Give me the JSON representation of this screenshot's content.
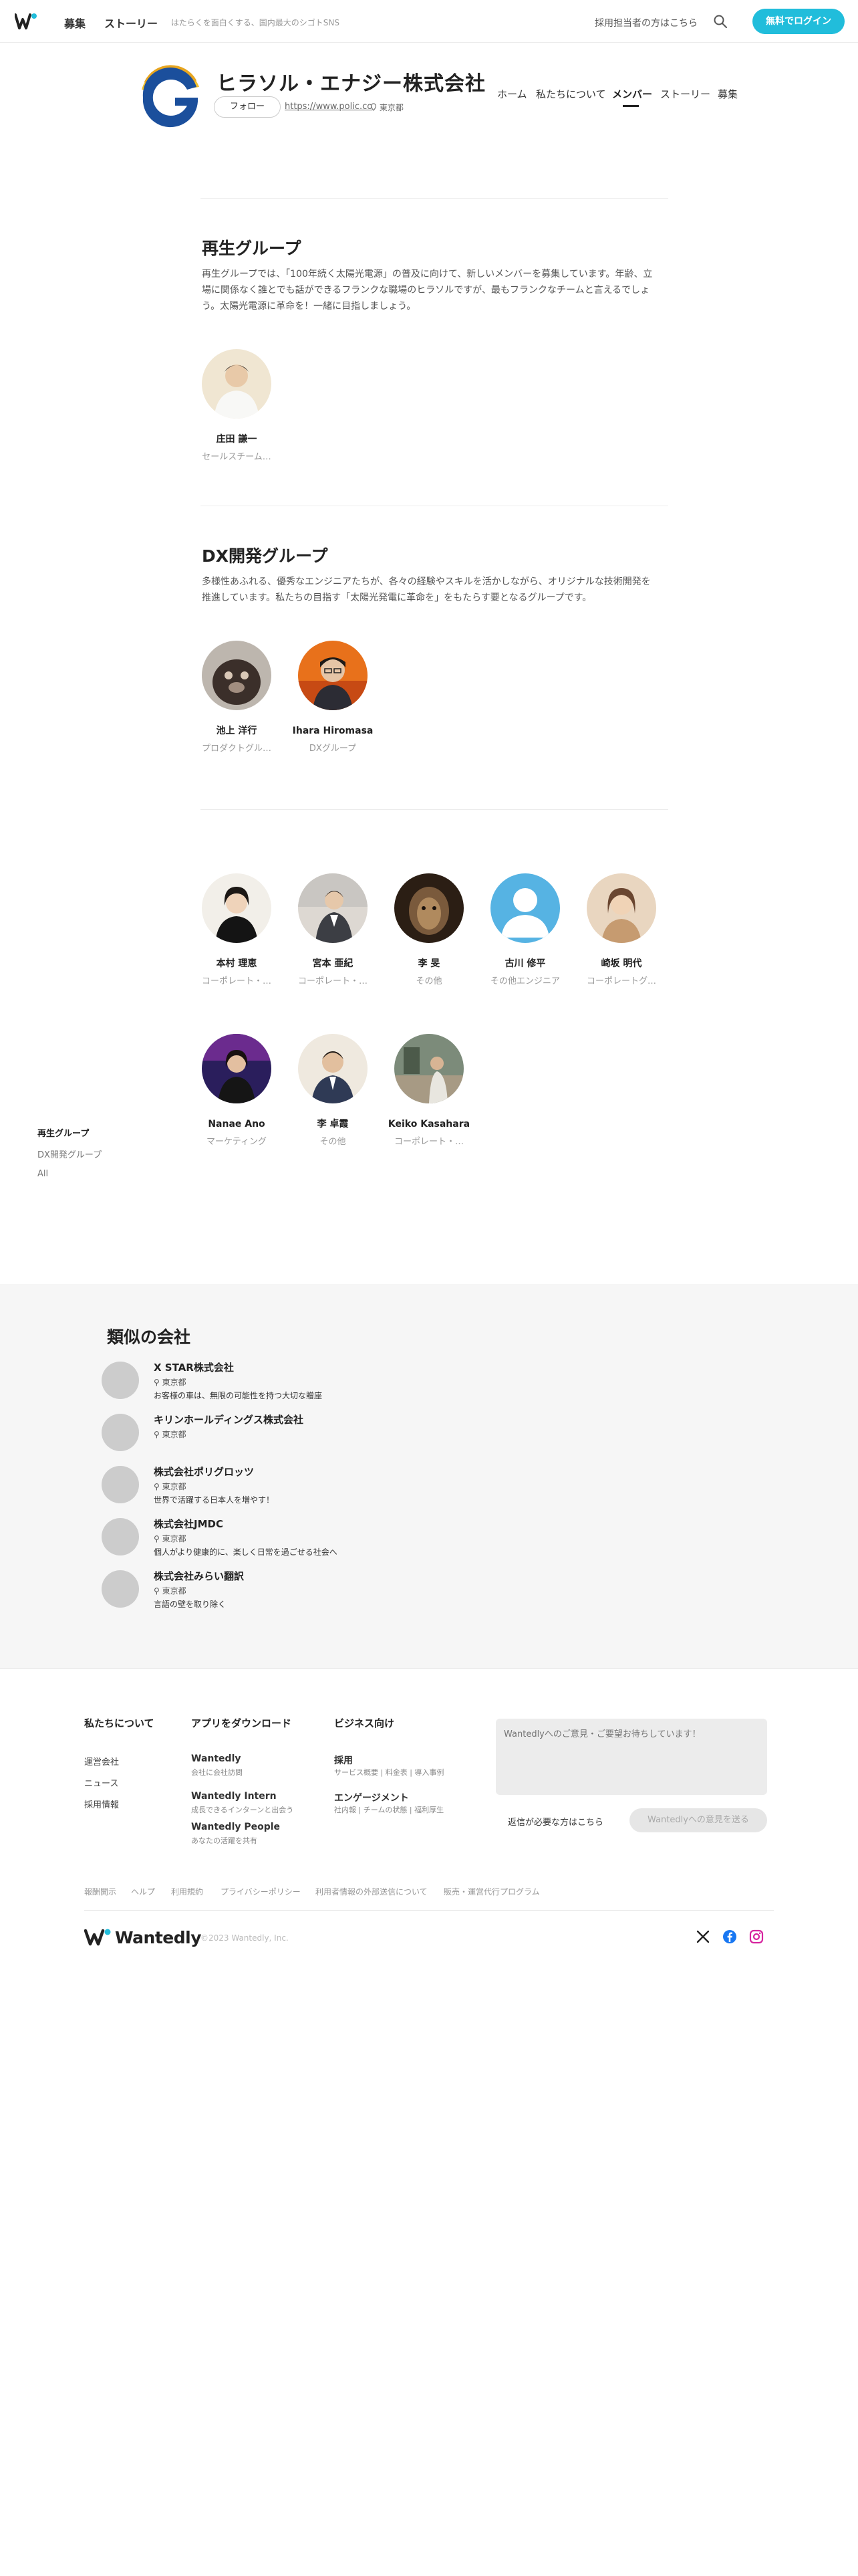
{
  "topnav": {
    "links": [
      "募集",
      "ストーリー"
    ],
    "tagline": "はたらくを面白くする、国内最大のシゴトSNS",
    "recruiter_link": "採用担当者の方はこちら",
    "login_button": "無料でログイン"
  },
  "company": {
    "name": "ヒラソル・エナジー株式会社",
    "follow_button": "フォロー",
    "url": "https://www.polic.co",
    "location": "東京都",
    "tabs": [
      "ホーム",
      "私たちについて",
      "メンバー",
      "ストーリー",
      "募集"
    ],
    "active_tab": "メンバー"
  },
  "groups": [
    {
      "title": "再生グループ",
      "description": "再生グループでは、「100年続く太陽光電源」の普及に向けて、新しいメンバーを募集しています。年齢、立場に関係なく誰とでも話ができるフランクな職場のヒラソルですが、最もフランクなチームと言えるでしょう。太陽光電源に革命を！一緒に目指しましょう。",
      "members": [
        {
          "name": "庄田 謙一",
          "role": "セールスチーム…"
        }
      ]
    },
    {
      "title": "DX開発グループ",
      "description": "多様性あふれる、優秀なエンジニアたちが、各々の経験やスキルを活かしながら、オリジナルな技術開発を推進しています。私たちの目指す「太陽光発電に革命を」をもたらす要となるグループです。",
      "members": [
        {
          "name": "池上 洋行",
          "role": "プロダクトグル…"
        },
        {
          "name": "Ihara Hiromasa",
          "role": "DXグループ"
        }
      ]
    },
    {
      "title": "",
      "members": [
        {
          "name": "本村 理恵",
          "role": "コーポレート・…"
        },
        {
          "name": "宮本 亜紀",
          "role": "コーポレート・…"
        },
        {
          "name": "李 旻",
          "role": "その他"
        },
        {
          "name": "古川 修平",
          "role": "その他エンジニア"
        },
        {
          "name": "崎坂 明代",
          "role": "コーポレートグ…"
        },
        {
          "name": "Nanae Ano",
          "role": "マーケティング"
        },
        {
          "name": "李 卓霞",
          "role": "その他"
        },
        {
          "name": "Keiko Kasahara",
          "role": "コーポレート・…"
        }
      ]
    }
  ],
  "side_nav": [
    "再生グループ",
    "DX開発グループ",
    "All"
  ],
  "similar": {
    "title": "類似の会社",
    "companies": [
      {
        "name": "X STAR株式会社",
        "location": "東京都",
        "desc": "お客様の車は、無限の可能性を持つ大切な贈座"
      },
      {
        "name": "キリンホールディングス株式会社",
        "location": "東京都",
        "desc": ""
      },
      {
        "name": "株式会社ポリグロッツ",
        "location": "東京都",
        "desc": "世界で活躍する日本人を増やす！"
      },
      {
        "name": "株式会社JMDC",
        "location": "東京都",
        "desc": "個人がより健康的に、楽しく日常を過ごせる社会へ"
      },
      {
        "name": "株式会社みらい翻訳",
        "location": "東京都",
        "desc": "言語の壁を取り除く"
      }
    ]
  },
  "footer": {
    "about_title": "私たちについて",
    "about_links": [
      "運営会社",
      "ニュース",
      "採用情報"
    ],
    "apps_title": "アプリをダウンロード",
    "apps": [
      {
        "name": "Wantedly",
        "sub": "会社に会社訪問"
      },
      {
        "name": "Wantedly Intern",
        "sub": "成長できるインターンと出会う"
      },
      {
        "name": "Wantedly People",
        "sub": "あなたの活躍を共有"
      }
    ],
    "biz_title": "ビジネス向け",
    "biz": [
      {
        "name": "採用",
        "sub": "サービス概要 | 料金表 | 導入事例"
      },
      {
        "name": "エンゲージメント",
        "sub": "社内報 | チームの状態 | 福利厚生"
      }
    ],
    "feedback_placeholder": "Wantedlyへのご意見・ご要望お待ちしています！",
    "reply_link": "返信が必要な方はこちら",
    "send_button": "Wantedlyへの意見を送る",
    "legal_links": [
      "報酬開示",
      "ヘルプ",
      "利用規約",
      "プライバシーポリシー",
      "利用者情報の外部送信について",
      "販売・運営代行プログラム"
    ],
    "brand": "Wantedly",
    "copyright": "©2023 Wantedly, Inc."
  },
  "colors": {
    "accent": "#21bddb",
    "brand_dark": "#222222",
    "footer_bg": "#f6f6f6"
  }
}
